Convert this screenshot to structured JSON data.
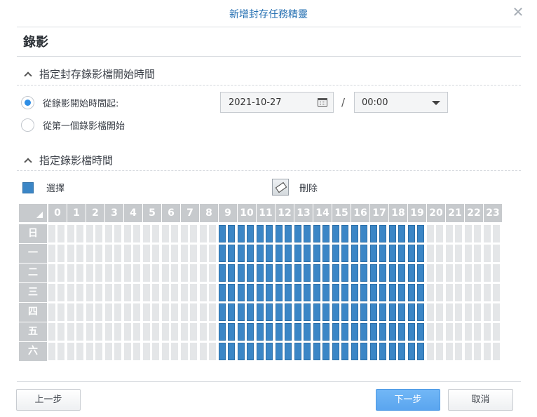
{
  "window": {
    "title": "新增封存任務精靈",
    "close_icon": "close-icon"
  },
  "page": {
    "title": "錄影"
  },
  "start_time_section": {
    "heading": "指定封存錄影檔開始時間",
    "option_from_time": "從錄影開始時間起:",
    "option_from_first": "從第一個錄影檔開始",
    "selected_option": "from_time",
    "date_value": "2021-10-27",
    "separator": "/",
    "time_value": "00:00"
  },
  "schedule_section": {
    "heading": "指定錄影檔時間",
    "select_tool_label": "選擇",
    "delete_tool_label": "刪除",
    "hours": [
      "0",
      "1",
      "2",
      "3",
      "4",
      "5",
      "6",
      "7",
      "8",
      "9",
      "10",
      "11",
      "12",
      "13",
      "14",
      "15",
      "16",
      "17",
      "18",
      "19",
      "20",
      "21",
      "22",
      "23"
    ],
    "days": [
      "日",
      "一",
      "二",
      "三",
      "四",
      "五",
      "六"
    ],
    "selected_hour_range": [
      9,
      19
    ],
    "selected_color": "#3b86c6",
    "empty_color": "#e4e6e8"
  },
  "footer": {
    "prev_label": "上一步",
    "next_label": "下一步",
    "cancel_label": "取消"
  }
}
